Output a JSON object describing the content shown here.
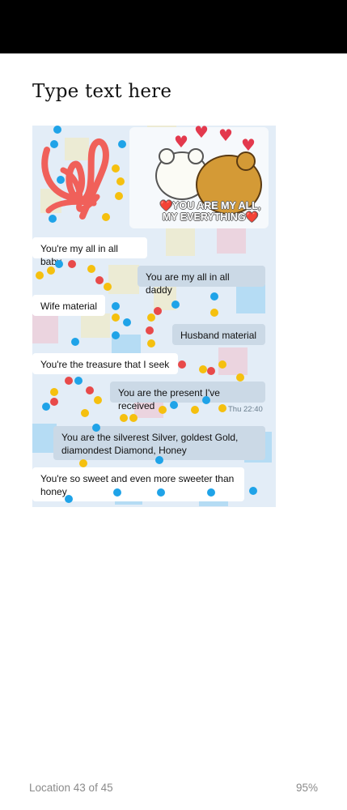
{
  "page": {
    "title": "Type text here"
  },
  "chat": {
    "sticker_caption": [
      "❤️YOU ARE MY ALL,",
      "MY EVERYTHING❤️"
    ],
    "messages": [
      {
        "side": "in",
        "text": "You're my all in all baby"
      },
      {
        "side": "out",
        "text": "You are my all in all daddy"
      },
      {
        "side": "in",
        "text": "Wife material"
      },
      {
        "side": "out",
        "text": "Husband material"
      },
      {
        "side": "in",
        "text": "You're the treasure that I seek"
      },
      {
        "side": "out",
        "text": "You are the present I've received"
      },
      {
        "side": "out",
        "text": "You are the silverest Silver, goldest Gold, diamondest Diamond, Honey"
      },
      {
        "side": "in",
        "text": "You're so sweet and even more sweeter than honey"
      }
    ],
    "timestamp": "Thu 22:40",
    "colors": {
      "incoming": "#ffffff",
      "outgoing": "#cbd9e6",
      "background": "#e3edf7",
      "scribble": "#f0605a"
    }
  },
  "footer": {
    "location": "Location 43 of 45",
    "percent": "95%"
  }
}
